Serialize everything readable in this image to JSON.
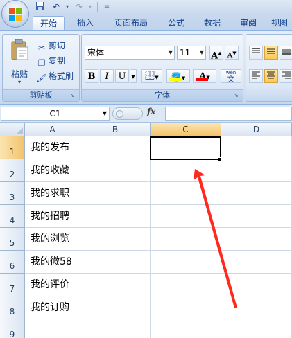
{
  "quick_access": {
    "dropdown_glyph": "▾",
    "customize_glyph": "="
  },
  "tabs": [
    {
      "label": "开始",
      "active": true
    },
    {
      "label": "插入",
      "active": false
    },
    {
      "label": "页面布局",
      "active": false
    },
    {
      "label": "公式",
      "active": false
    },
    {
      "label": "数据",
      "active": false
    },
    {
      "label": "审阅",
      "active": false
    },
    {
      "label": "视图",
      "active": false
    }
  ],
  "clipboard": {
    "group_label": "剪贴板",
    "paste_label": "粘贴",
    "cut_label": "剪切",
    "copy_label": "复制",
    "format_painter_label": "格式刷"
  },
  "font": {
    "group_label": "字体",
    "font_name": "宋体",
    "font_size": "11",
    "grow_label": "A",
    "shrink_label": "A",
    "bold_label": "B",
    "italic_label": "I",
    "underline_label": "U",
    "font_color_label": "A",
    "phonetic_label": "wén",
    "phonetic_char": "文",
    "fill_color": "#ffff00",
    "font_color": "#ff0000"
  },
  "formula_bar": {
    "name_box": "C1",
    "fx_label": "fx",
    "value": ""
  },
  "columns": [
    {
      "label": "A",
      "selected": false
    },
    {
      "label": "B",
      "selected": false
    },
    {
      "label": "C",
      "selected": true
    },
    {
      "label": "D",
      "selected": false
    }
  ],
  "rows": [
    {
      "label": "1",
      "a": "我的发布",
      "selected": true
    },
    {
      "label": "2",
      "a": "我的收藏",
      "selected": false
    },
    {
      "label": "3",
      "a": "我的求职",
      "selected": false
    },
    {
      "label": "4",
      "a": "我的招聘",
      "selected": false
    },
    {
      "label": "5",
      "a": "我的浏览",
      "selected": false
    },
    {
      "label": "6",
      "a": "我的微58",
      "selected": false
    },
    {
      "label": "7",
      "a": "我的评价",
      "selected": false
    },
    {
      "label": "8",
      "a": "我的订购",
      "selected": false
    },
    {
      "label": "9",
      "a": "",
      "selected": false
    }
  ],
  "colors": {
    "annotation_arrow": "#ff2a1f",
    "selection_header": "#f4c26a",
    "ribbon": "#dbe6f4"
  }
}
